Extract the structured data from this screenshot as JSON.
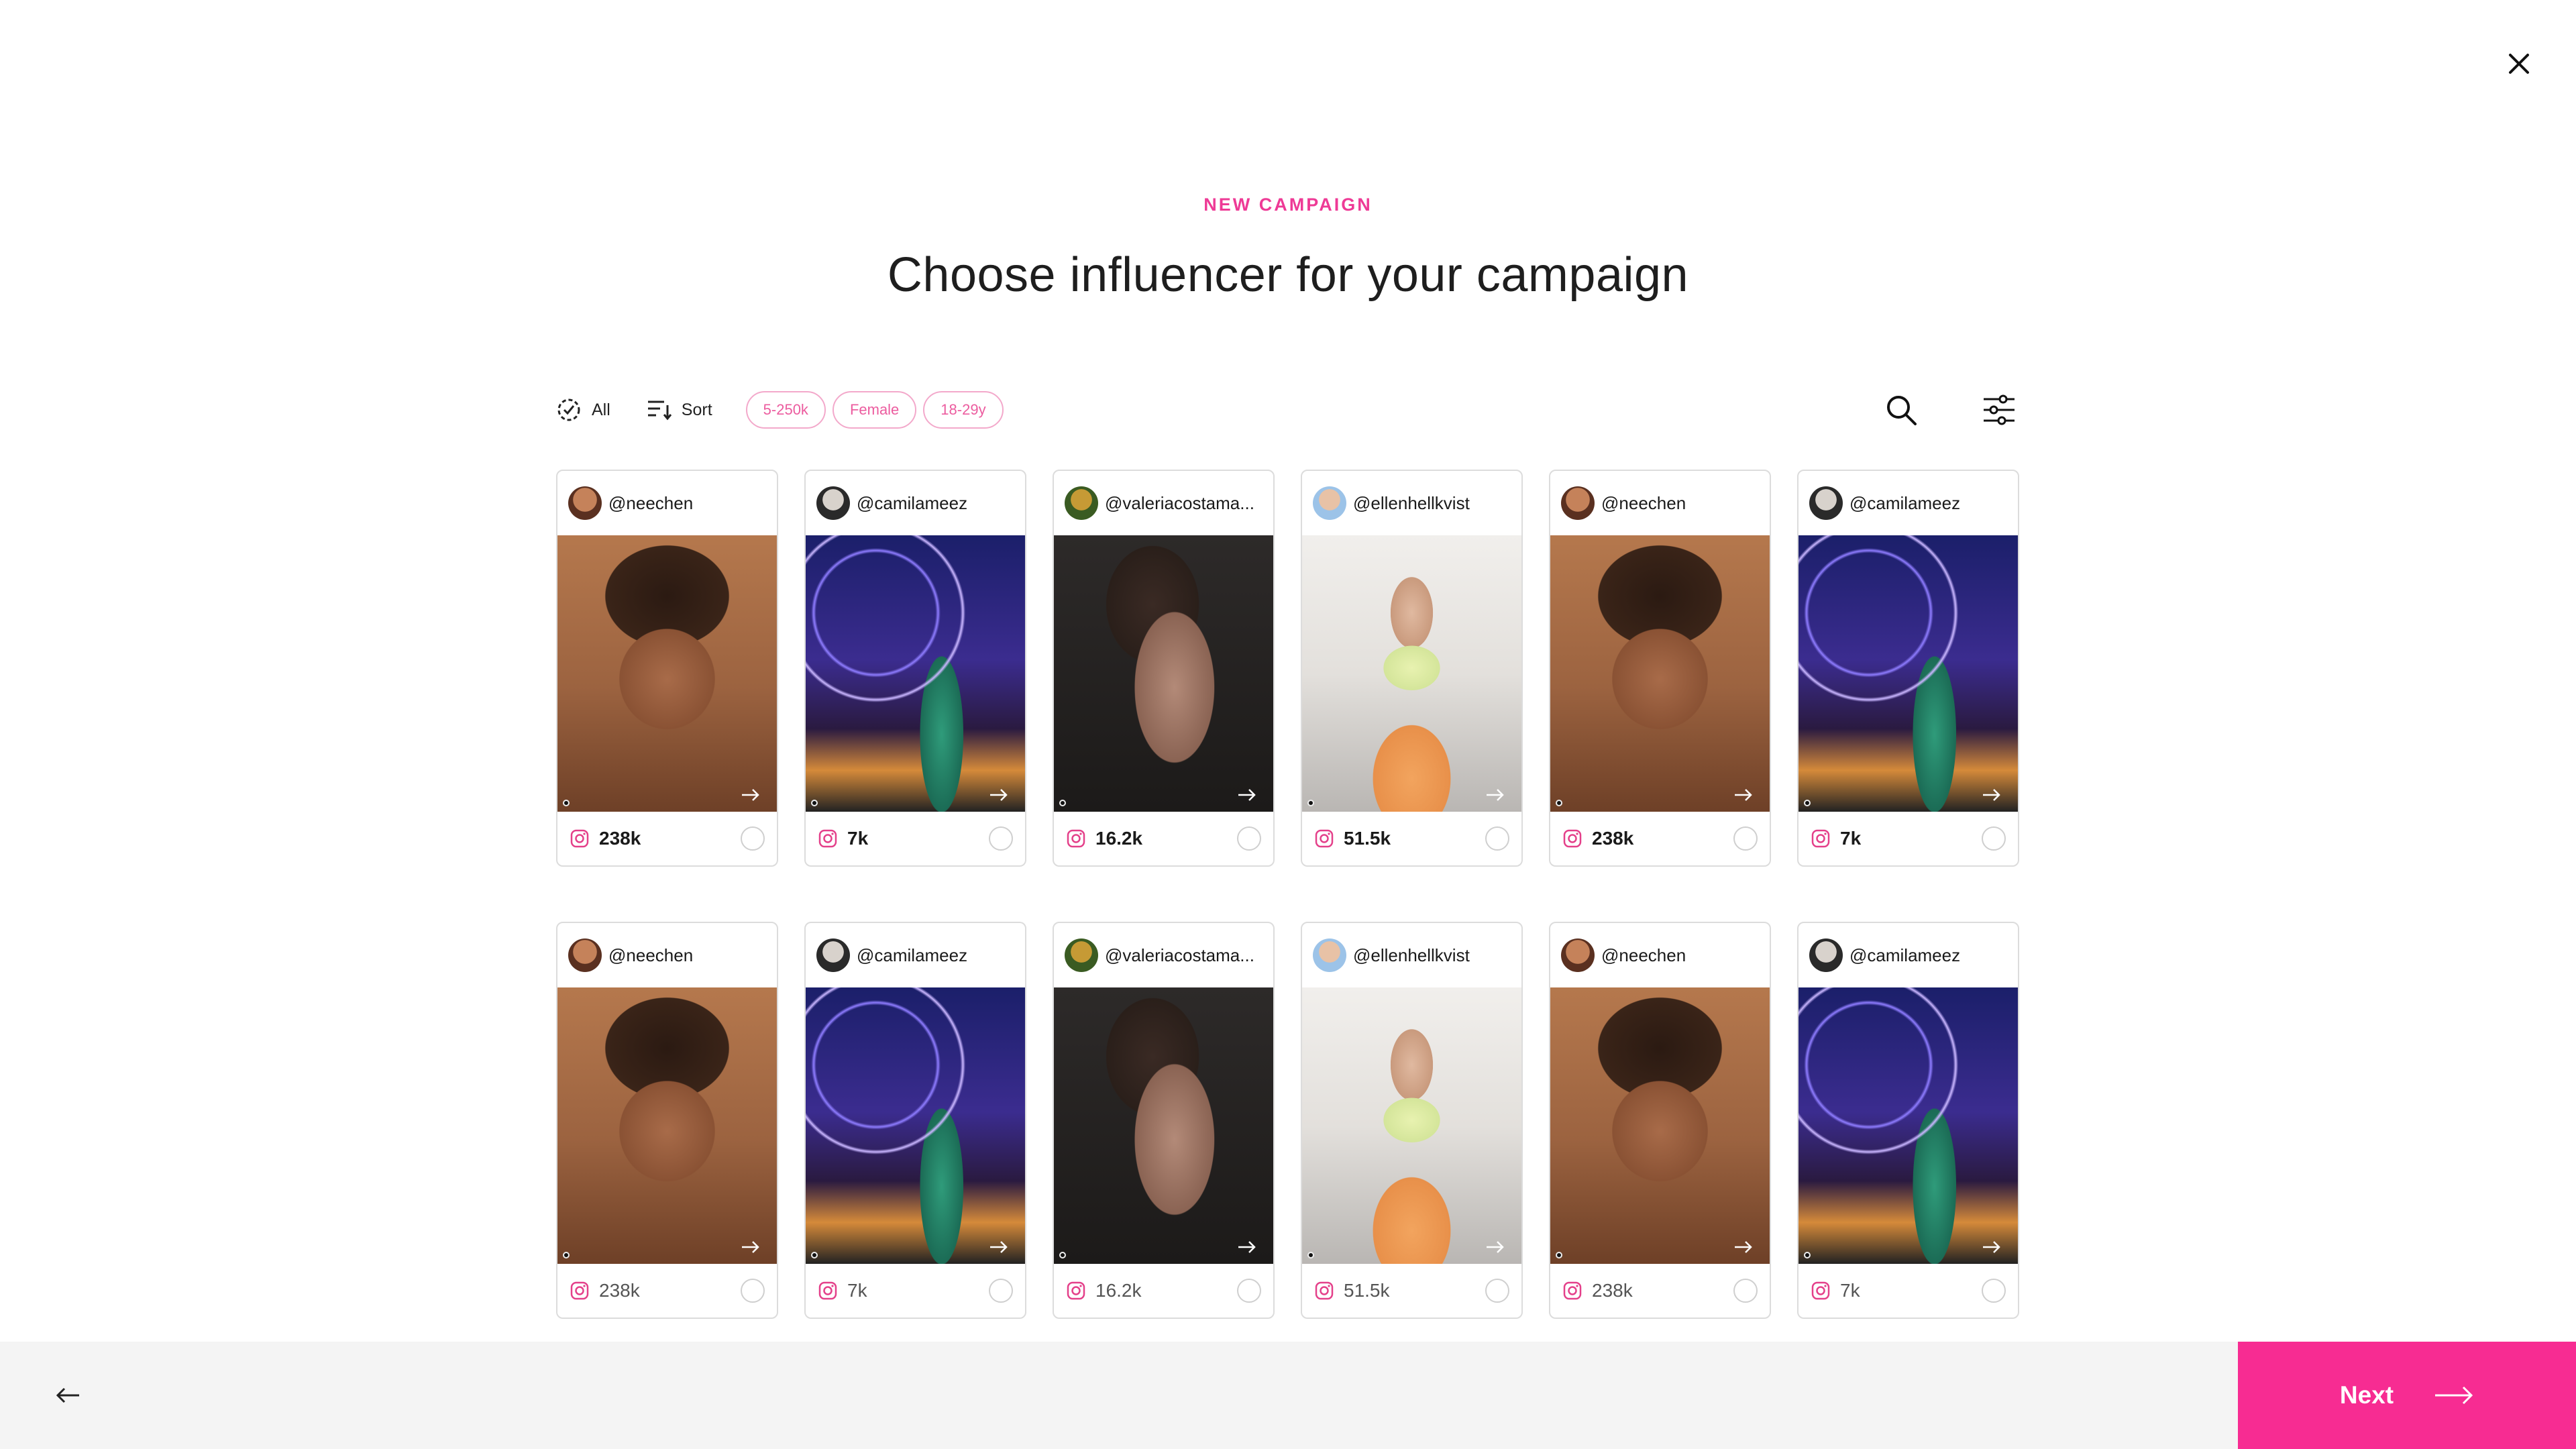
{
  "header": {
    "kicker": "NEW CAMPAIGN",
    "title": "Choose influencer for your campaign"
  },
  "toolbar": {
    "all_label": "All",
    "sort_label": "Sort",
    "chips": [
      "5-250k",
      "Female",
      "18-29y"
    ]
  },
  "influencers_row1": [
    {
      "handle": "@neechen",
      "followers": "238k",
      "photo": "neechen"
    },
    {
      "handle": "@camilameez",
      "followers": "7k",
      "photo": "camila"
    },
    {
      "handle": "@valeriacostama...",
      "followers": "16.2k",
      "photo": "valeria"
    },
    {
      "handle": "@ellenhellkvist",
      "followers": "51.5k",
      "photo": "ellen"
    },
    {
      "handle": "@neechen",
      "followers": "238k",
      "photo": "neechen"
    },
    {
      "handle": "@camilameez",
      "followers": "7k",
      "photo": "camila"
    }
  ],
  "influencers_row2": [
    {
      "handle": "@neechen",
      "followers": "238k",
      "photo": "neechen"
    },
    {
      "handle": "@camilameez",
      "followers": "7k",
      "photo": "camila"
    },
    {
      "handle": "@valeriacostama...",
      "followers": "16.2k",
      "photo": "valeria"
    },
    {
      "handle": "@ellenhellkvist",
      "followers": "51.5k",
      "photo": "ellen"
    },
    {
      "handle": "@neechen",
      "followers": "238k",
      "photo": "neechen"
    },
    {
      "handle": "@camilameez",
      "followers": "7k",
      "photo": "camila"
    }
  ],
  "footer": {
    "next_label": "Next"
  },
  "colors": {
    "accent": "#f72c92",
    "kicker": "#ee3a96",
    "chip_border": "#f3a9cb",
    "instagram": "#e4408a"
  },
  "icons": {
    "close": "close-icon",
    "all": "all-filter-icon",
    "sort": "sort-icon",
    "search": "search-icon",
    "filters": "filters-sliders-icon",
    "platform": "instagram-icon",
    "back": "arrow-left-icon",
    "next": "arrow-right-icon"
  }
}
